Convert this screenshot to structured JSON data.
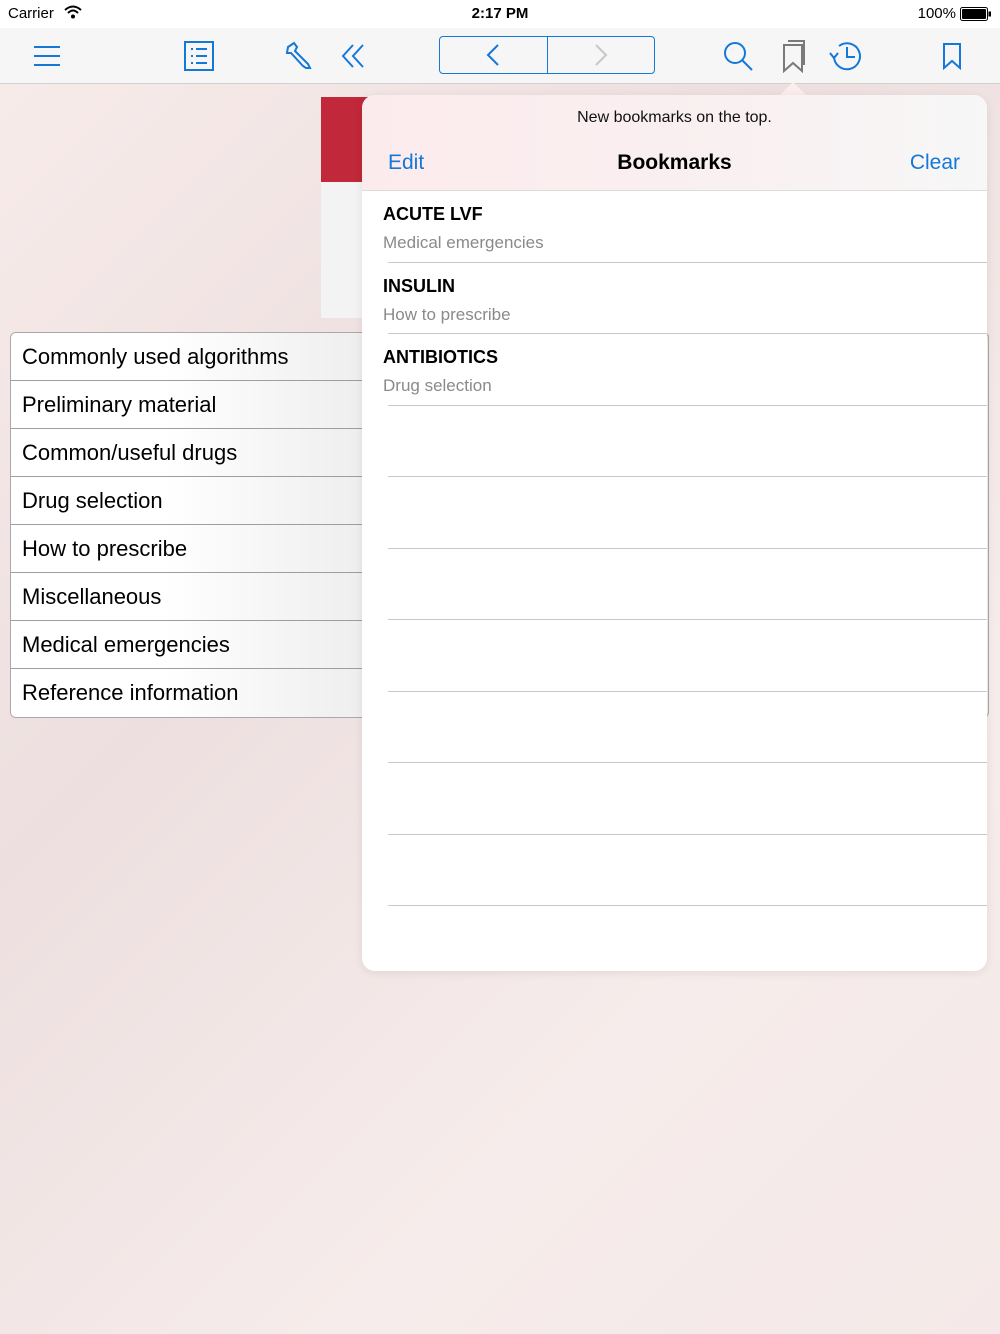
{
  "status_bar": {
    "carrier": "Carrier",
    "time": "2:17 PM",
    "battery": "100%"
  },
  "toolbar": {
    "icons": [
      "menu-icon",
      "list-icon",
      "wrench-icon",
      "double-chevron-left-icon",
      "chevron-left-icon",
      "chevron-right-icon",
      "search-icon",
      "bookmarks-icon",
      "history-icon",
      "bookmark-icon"
    ]
  },
  "menu": {
    "items": [
      "Commonly used algorithms",
      "Preliminary material",
      "Common/useful drugs",
      "Drug selection",
      "How to prescribe",
      "Miscellaneous",
      "Medical emergencies",
      "Reference information"
    ]
  },
  "popover": {
    "note": "New bookmarks on the top.",
    "edit_label": "Edit",
    "title": "Bookmarks",
    "clear_label": "Clear",
    "bookmarks": [
      {
        "title": "ACUTE LVF",
        "subtitle": "Medical emergencies"
      },
      {
        "title": "INSULIN",
        "subtitle": "How to prescribe"
      },
      {
        "title": "ANTIBIOTICS",
        "subtitle": "Drug selection"
      },
      {
        "title": "",
        "subtitle": ""
      },
      {
        "title": "",
        "subtitle": ""
      },
      {
        "title": "",
        "subtitle": ""
      },
      {
        "title": "",
        "subtitle": ""
      },
      {
        "title": "",
        "subtitle": ""
      },
      {
        "title": "",
        "subtitle": ""
      },
      {
        "title": "",
        "subtitle": ""
      }
    ]
  },
  "colors": {
    "accent": "#1478d8",
    "logo_red": "#c1283a"
  }
}
